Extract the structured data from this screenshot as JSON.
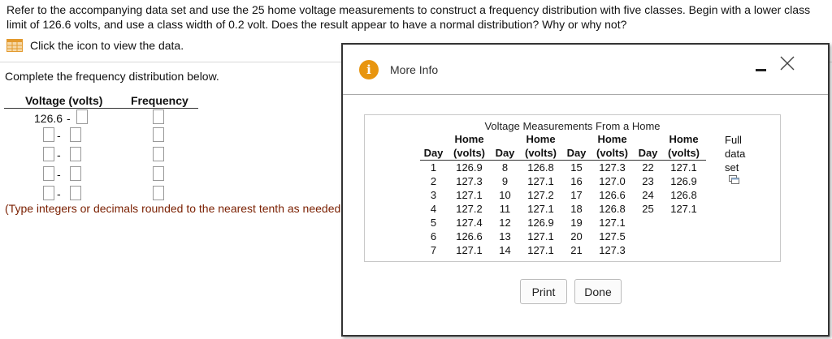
{
  "question": "Refer to the accompanying data set and use the 25 home voltage measurements to construct a frequency distribution with five classes. Begin with a lower class limit of 126.6 volts, and use a class width of 0.2 volt. Does the result appear to have a normal distribution? Why or why not?",
  "data_link_label": "Click the icon to view the data.",
  "instruction": "Complete the frequency distribution below.",
  "freq_table": {
    "voltage_header": "Voltage (volts)",
    "frequency_header": "Frequency",
    "first_lower": "126.6",
    "dash": "-"
  },
  "hint": "(Type integers or decimals rounded to the nearest tenth as needed.)",
  "dialog": {
    "title": "More Info",
    "panel_title": "Voltage Measurements From a Home",
    "col_day": "Day",
    "col_home": "Home",
    "col_volts": "(volts)",
    "full_set_line1": "Full",
    "full_set_line2": "data",
    "full_set_line3": "set",
    "rows": [
      [
        "1",
        "126.9",
        "8",
        "126.8",
        "15",
        "127.3",
        "22",
        "127.1"
      ],
      [
        "2",
        "127.3",
        "9",
        "127.1",
        "16",
        "127.0",
        "23",
        "126.9"
      ],
      [
        "3",
        "127.1",
        "10",
        "127.2",
        "17",
        "126.6",
        "24",
        "126.8"
      ],
      [
        "4",
        "127.2",
        "11",
        "127.1",
        "18",
        "126.8",
        "25",
        "127.1"
      ],
      [
        "5",
        "127.4",
        "12",
        "126.9",
        "19",
        "127.1",
        "",
        ""
      ],
      [
        "6",
        "126.6",
        "13",
        "127.1",
        "20",
        "127.5",
        "",
        ""
      ],
      [
        "7",
        "127.1",
        "14",
        "127.1",
        "21",
        "127.3",
        "",
        ""
      ]
    ],
    "print_label": "Print",
    "done_label": "Done"
  },
  "icons": {
    "data_table": "table-icon",
    "info": "info-icon",
    "minimize": "minimize-icon",
    "close": "close-icon",
    "copy": "copy-icon"
  },
  "colors": {
    "info_accent": "#e8950f",
    "hint_text": "#7a1f00"
  }
}
